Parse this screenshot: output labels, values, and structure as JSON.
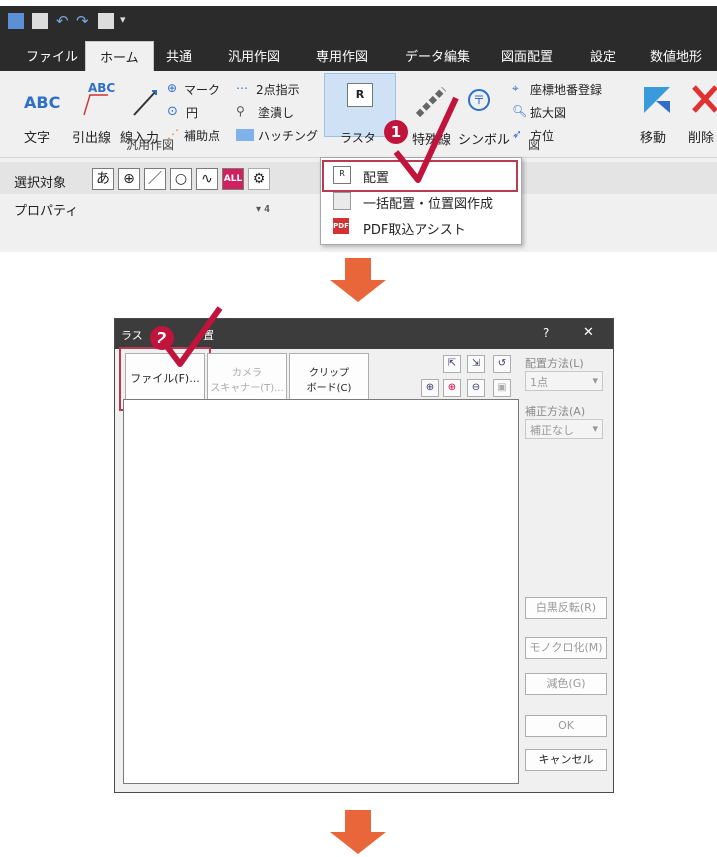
{
  "ribbon_window": {
    "tabs": [
      "ファイル",
      "ホーム",
      "共通",
      "汎用作図",
      "専用作図",
      "データ編集",
      "図面配置",
      "設定",
      "数値地形"
    ],
    "active_tab": "ホーム",
    "commands": {
      "text": "文字",
      "text_icon": "ABC",
      "leader": "引出線",
      "leader_icon": "ABC",
      "line_input": "線入力",
      "mark": "マーク",
      "circle": "円",
      "aux_point": "補助点",
      "two_point": "2点指示",
      "fill": "塗潰し",
      "hatching": "ハッチング",
      "raster": "ラスタ",
      "raster_icon": "R",
      "special_line": "特殊線",
      "symbol": "シンボル",
      "coord_register": "座標地番登録",
      "zoom_view": "拡大図",
      "bearing": "方位",
      "move": "移動",
      "delete": "削除"
    },
    "group_label": "汎用作図",
    "group_label_right": "図",
    "selection_label": "選択対象",
    "selection_buttons": [
      "あ",
      "⊕",
      "／",
      "○",
      "∿",
      "ALL",
      "⚙"
    ],
    "property_label": "プロパティ",
    "property_pin": "▾ 𝟒",
    "dropdown": {
      "items": [
        {
          "label": "配置",
          "icon": "raster-place-icon"
        },
        {
          "label": "一括配置・位置図作成",
          "icon": "batch-place-icon"
        },
        {
          "label": "PDF取込アシスト",
          "icon": "pdf-icon"
        }
      ]
    },
    "step_badge": "1"
  },
  "dialog": {
    "title_partial": "ラス",
    "title_partial2": "置",
    "help": "?",
    "close": "✕",
    "file_button": "ファイル(F)...",
    "camera_button_line1": "カメラ",
    "camera_button_line2": "スキャナー(T)...",
    "clipboard_line1": "クリップ",
    "clipboard_line2": "ボード(C)",
    "placement_method_label": "配置方法(L)",
    "placement_method_value": "1点",
    "correction_method_label": "補正方法(A)",
    "correction_method_value": "補正なし",
    "invert_button": "白黒反転(R)",
    "mono_button": "モノクロ化(M)",
    "reduce_button": "減色(G)",
    "ok_button": "OK",
    "cancel_button": "キャンセル",
    "step_badge": "2"
  },
  "colors": {
    "accent_red": "#c0143c",
    "highlight_border": "#b93a52",
    "arrow_orange": "#e8663a",
    "checkmark": "#c0143c",
    "dark_bar": "#2b2b2b"
  }
}
